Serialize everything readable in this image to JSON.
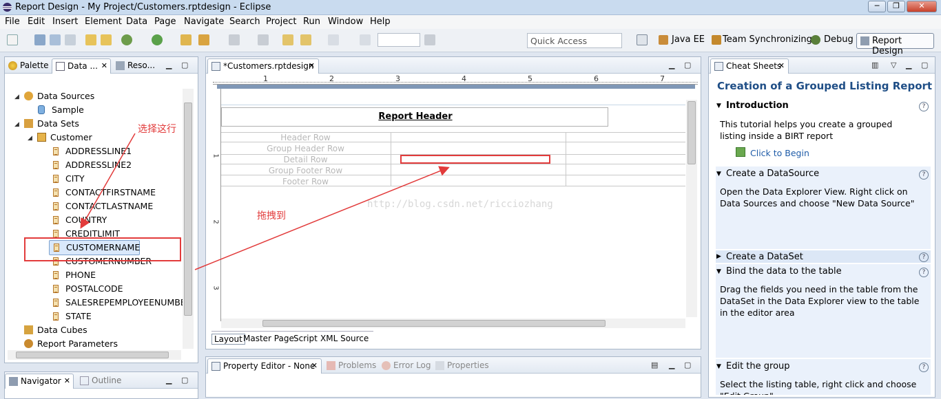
{
  "window": {
    "title": "Report Design - My Project/Customers.rptdesign - Eclipse",
    "minimize": "─",
    "maximize": "❐",
    "close": "✕"
  },
  "menu": [
    "File",
    "Edit",
    "Insert",
    "Element",
    "Data",
    "Page",
    "Navigate",
    "Search",
    "Project",
    "Run",
    "Window",
    "Help"
  ],
  "toolbar": {
    "quick_access_placeholder": "Quick Access",
    "perspectives": [
      "Java EE",
      "Team Synchronizing",
      "Debug",
      "Report Design"
    ]
  },
  "left_panel": {
    "tabs": [
      "Palette",
      "Data ...",
      "Reso..."
    ],
    "tree": {
      "data_sources": "Data Sources",
      "sample": "Sample",
      "data_sets": "Data Sets",
      "customer": "Customer",
      "columns": [
        "ADDRESSLINE1",
        "ADDRESSLINE2",
        "CITY",
        "CONTACTFIRSTNAME",
        "CONTACTLASTNAME",
        "COUNTRY",
        "CREDITLIMIT",
        "CUSTOMERNAME",
        "CUSTOMERNUMBER",
        "PHONE",
        "POSTALCODE",
        "SALESREPEMPLOYEENUMBER",
        "STATE"
      ],
      "selected_column": "CUSTOMERNAME",
      "data_cubes": "Data Cubes",
      "report_parameters": "Report Parameters"
    },
    "annotation_select": "选择这行"
  },
  "bottom_left_panel": {
    "tabs": [
      "Navigator",
      "Outline"
    ]
  },
  "editor": {
    "tab": "*Customers.rptdesign",
    "ruler_marks": [
      "1",
      "2",
      "3",
      "4",
      "5",
      "6",
      "7"
    ],
    "vertical_ruler_marks": [
      "1",
      "2",
      "3"
    ],
    "report_header": "Report Header",
    "rows": [
      "Header Row",
      "Group Header Row",
      "Detail Row",
      "Group Footer Row",
      "Footer Row"
    ],
    "watermark": "http://blog.csdn.net/ricciozhang",
    "annotation_drag": "拖拽到",
    "bottom_tabs": [
      "Layout",
      "Master Page",
      "Script",
      "XML Source"
    ]
  },
  "bottom_panel": {
    "tabs": [
      "Property Editor - None",
      "Problems",
      "Error Log",
      "Properties"
    ]
  },
  "cheat_sheet": {
    "tab": "Cheat Sheets",
    "title": "Creation of a Grouped Listing Report",
    "sections": [
      {
        "heading": "Introduction",
        "body": "This tutorial helps you create a grouped listing inside a BIRT report",
        "link": "Click to Begin"
      },
      {
        "heading": "Create a DataSource",
        "body": "Open the Data Explorer View. Right click on Data Sources and choose \"New Data Source\""
      },
      {
        "heading": "Create a DataSet",
        "body": ""
      },
      {
        "heading": "Bind the data to the table",
        "body": "Drag the fields you need in the table from the DataSet in the Data Explorer view to the table in the editor area"
      },
      {
        "heading": "Edit the group",
        "body": "Select the listing table, right click and choose \"Edit Group\""
      }
    ]
  },
  "colors": {
    "accent": "#1f4e86",
    "annotation": "#e23b3b",
    "link": "#1f5ca8"
  }
}
